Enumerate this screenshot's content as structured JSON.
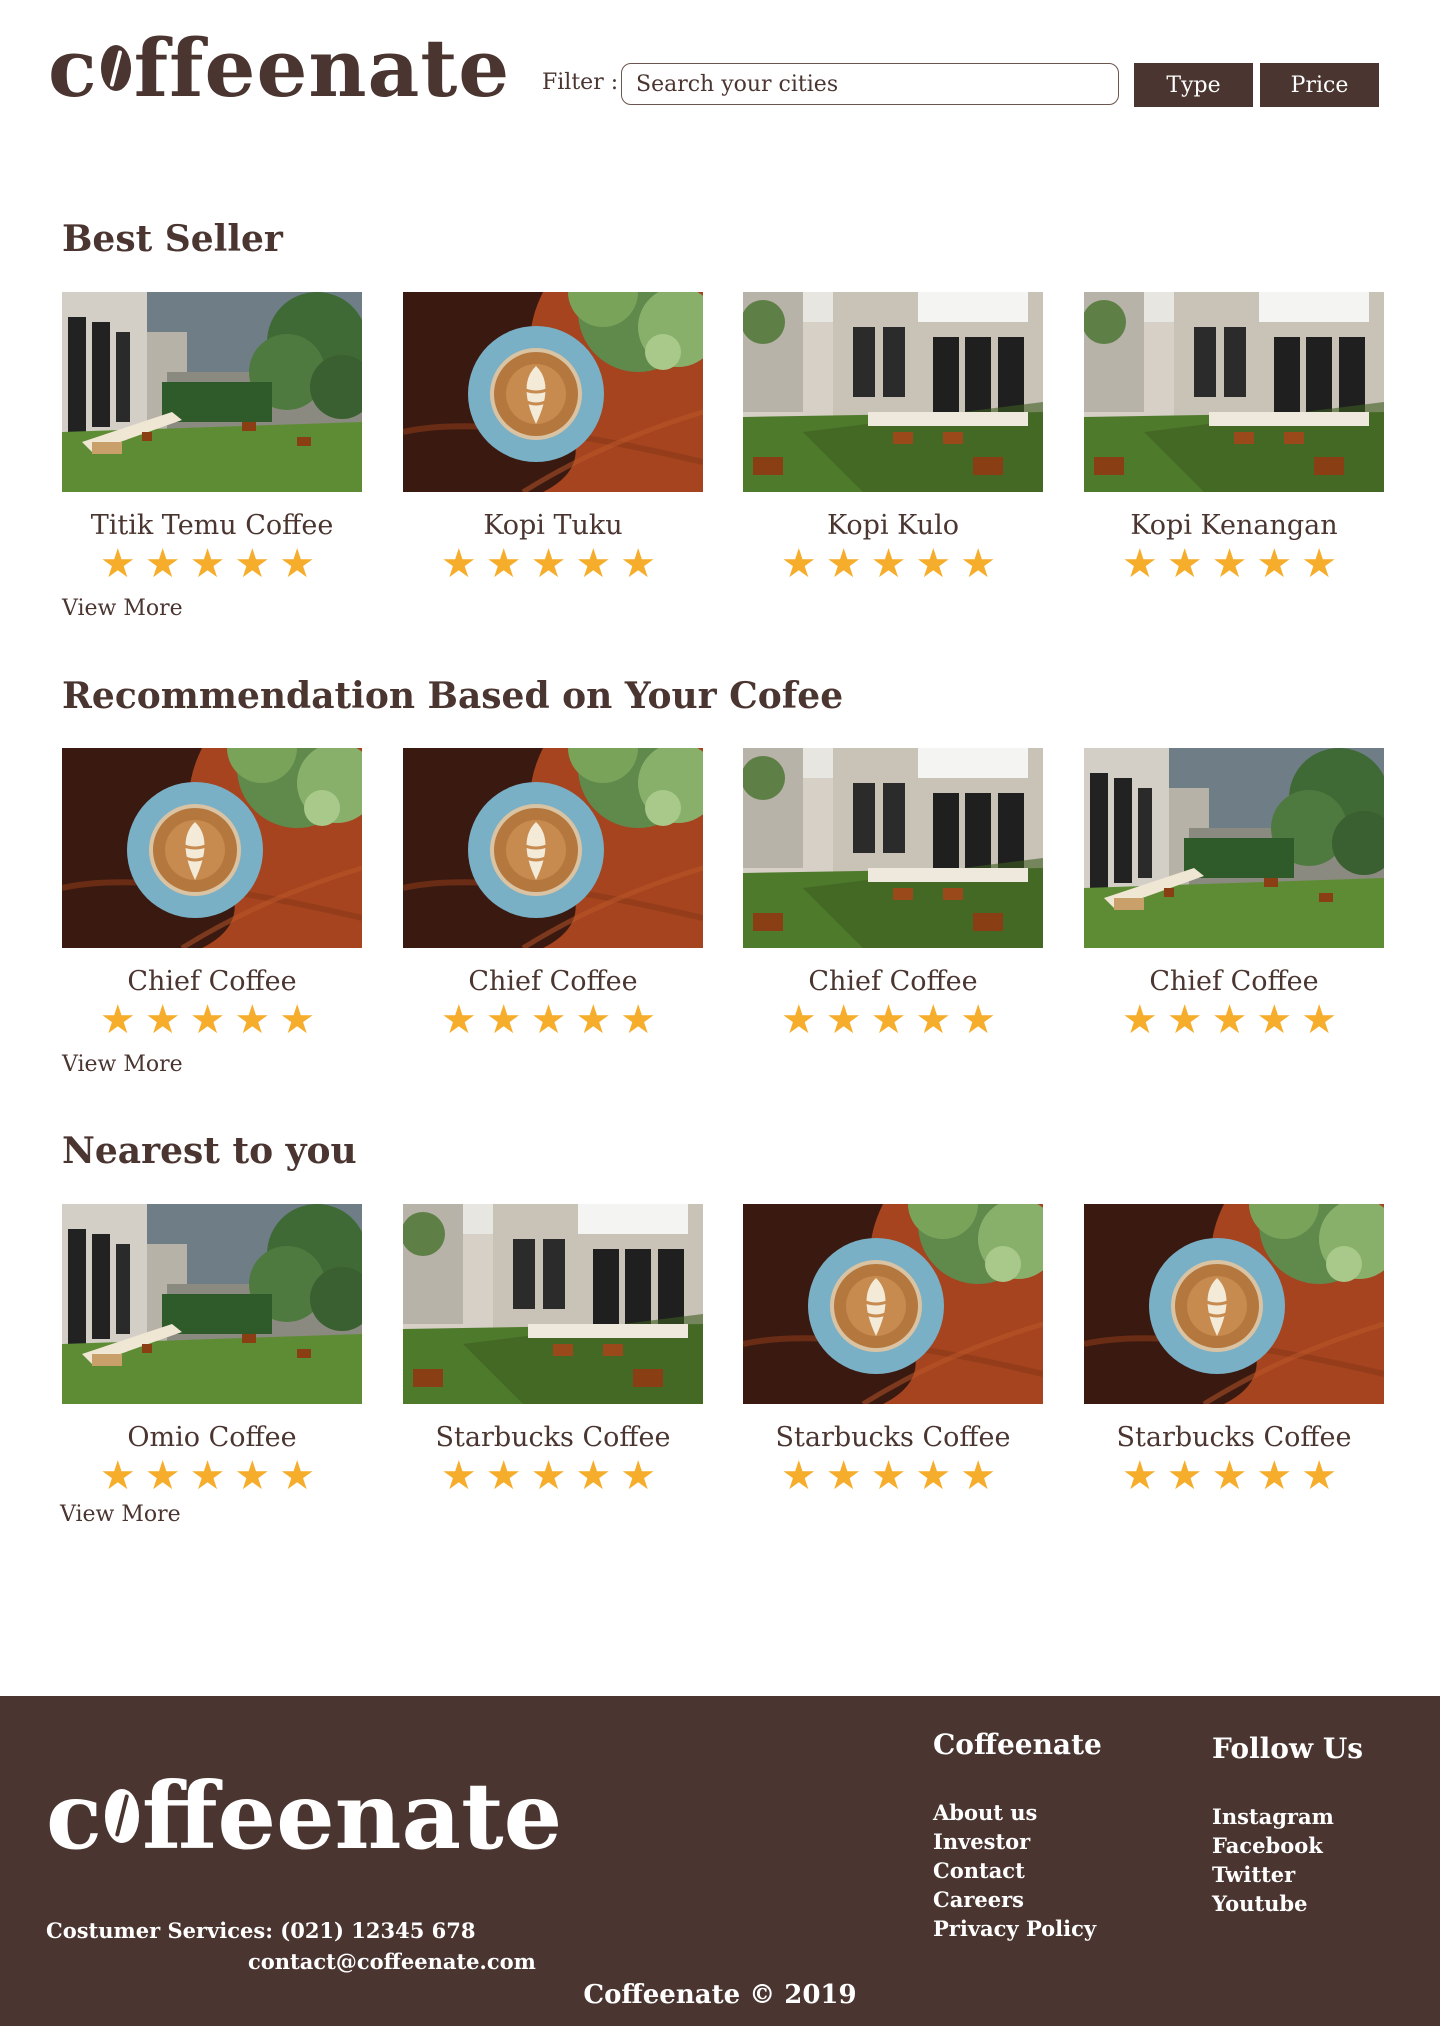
{
  "header": {
    "logo_text_before": "c",
    "logo_text_after": "ffeenate",
    "filter_label": "Filter :",
    "search_placeholder": "Search your cities",
    "type_button": "Type",
    "price_button": "Price"
  },
  "sections": [
    {
      "title": "Best Seller",
      "view_more": "View More",
      "cards": [
        {
          "name": "Titik Temu Coffee",
          "image": "garden-cafe",
          "rating": 5
        },
        {
          "name": "Kopi Tuku",
          "image": "latte-art",
          "rating": 5
        },
        {
          "name": "Kopi Kulo",
          "image": "cafe-building",
          "rating": 5
        },
        {
          "name": "Kopi Kenangan",
          "image": "cafe-building",
          "rating": 5
        }
      ]
    },
    {
      "title": "Recommendation Based on Your Cofee",
      "view_more": "View More",
      "cards": [
        {
          "name": "Chief Coffee",
          "image": "latte-art",
          "rating": 5
        },
        {
          "name": "Chief Coffee",
          "image": "latte-art",
          "rating": 5
        },
        {
          "name": "Chief Coffee",
          "image": "cafe-building",
          "rating": 5
        },
        {
          "name": "Chief Coffee",
          "image": "garden-cafe",
          "rating": 5
        }
      ]
    },
    {
      "title": "Nearest to you",
      "view_more": "View More",
      "cards": [
        {
          "name": "Omio Coffee",
          "image": "garden-cafe",
          "rating": 5
        },
        {
          "name": "Starbucks Coffee",
          "image": "cafe-building",
          "rating": 5
        },
        {
          "name": "Starbucks Coffee",
          "image": "latte-art",
          "rating": 5
        },
        {
          "name": "Starbucks Coffee",
          "image": "latte-art",
          "rating": 5
        }
      ]
    }
  ],
  "footer": {
    "logo_text_before": "c",
    "logo_text_after": "ffeenate",
    "customer_service": "Costumer Services: (021) 12345 678",
    "email": "contact@coffeenate.com",
    "col1_title": "Coffeenate",
    "col1_links": [
      "About us",
      "Investor",
      "Contact",
      "Careers",
      "Privacy Policy"
    ],
    "col2_title": "Follow Us",
    "col2_links": [
      "Instagram",
      "Facebook",
      "Twitter",
      "Youtube"
    ],
    "copyright": "Coffeenate © 2019"
  },
  "colors": {
    "brand_brown": "#4a3530",
    "star_orange": "#f6ad2b",
    "background": "#ffffff"
  },
  "icons": {
    "rating": "star-icon",
    "logo_bean": "coffee-bean-icon"
  }
}
